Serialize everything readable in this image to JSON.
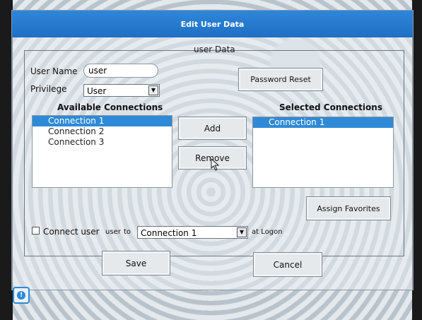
{
  "dialog": {
    "title": "Edit User Data",
    "group_label": "user Data",
    "user_name_label": "User Name",
    "user_name_value": "user",
    "privilege_label": "Privilege",
    "privilege_value": "User",
    "password_reset_label": "Password Reset",
    "available_header": "Available Connections",
    "available_items": [
      "Connection 1",
      "Connection 2",
      "Connection 3"
    ],
    "add_label": "Add",
    "remove_label": "Remove",
    "selected_header": "Selected Connections",
    "selected_items": [
      "Connection 1"
    ],
    "assign_favorites_label": "Assign Favorites",
    "connect_user_label": "Connect user",
    "connect_user_checked": false,
    "connect_user_name": "user",
    "connect_to_label": "to",
    "connect_target_value": "Connection 1",
    "at_logon_label": "at Logon",
    "save_label": "Save",
    "cancel_label": "Cancel"
  },
  "status_icon": {
    "name": "info-icon",
    "glyph": "!"
  },
  "colors": {
    "titlebar": "#2f86d9",
    "selection": "#2e8ad6"
  }
}
